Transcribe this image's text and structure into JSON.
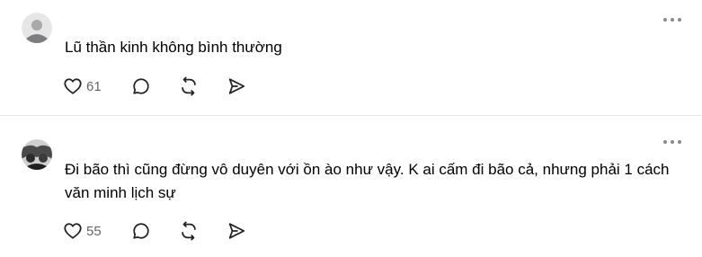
{
  "posts": [
    {
      "text": "Lũ thần kinh không bình thường",
      "likes": "61",
      "icons": {
        "avatar": "default-avatar-icon",
        "like": "heart-icon",
        "reply": "comment-icon",
        "repost": "repost-icon",
        "share": "send-icon",
        "more": "more-dots-icon"
      }
    },
    {
      "text": "Đi bão thì cũng đừng vô duyên với ồn ào như vậy. K ai cấm đi bão cả, nhưng phải 1 cách văn minh lịch sự",
      "likes": "55",
      "icons": {
        "avatar": "profile-photo-avatar",
        "like": "heart-icon",
        "reply": "comment-icon",
        "repost": "repost-icon",
        "share": "send-icon",
        "more": "more-dots-icon"
      }
    }
  ],
  "colors": {
    "text": "#000000",
    "secondary": "#666666",
    "icon": "#222222",
    "divider": "#e5e5e5",
    "more_dots": "#8a8a8a"
  }
}
